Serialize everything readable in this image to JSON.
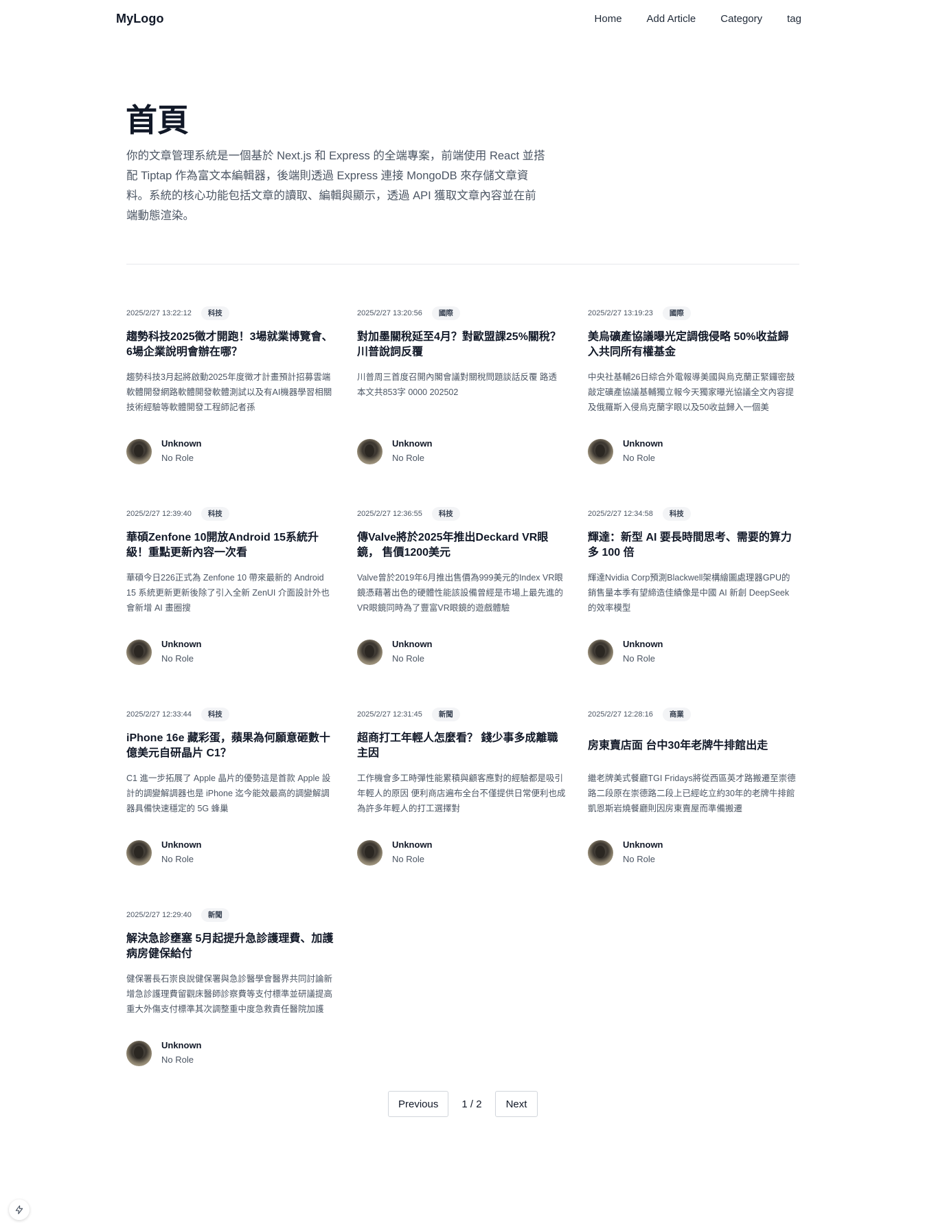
{
  "header": {
    "logo": "MyLogo",
    "nav": [
      "Home",
      "Add Article",
      "Category",
      "tag"
    ]
  },
  "hero": {
    "title": "首頁",
    "description": "你的文章管理系統是一個基於 Next.js 和 Express 的全端專案，前端使用 React 並搭配 Tiptap 作為富文本編輯器，後端則透過 Express 連接 MongoDB 來存儲文章資料。系統的核心功能包括文章的讀取、編輯與顯示，透過 API 獲取文章內容並在前端動態渲染。"
  },
  "articles": [
    {
      "date": "2025/2/27 13:22:12",
      "category": "科技",
      "title": "趨勢科技2025徵才開跑！3場就業博覽會、6場企業說明會辦在哪？",
      "excerpt": "趨勢科技3月起將啟動2025年度徵才計畫預計招募雲端軟體開發網路軟體開發軟體測試以及有AI機器學習相關技術經驗等軟體開發工程師記者孫",
      "author": "Unknown",
      "role": "No Role"
    },
    {
      "date": "2025/2/27 13:20:56",
      "category": "國際",
      "title": "對加墨關稅延至4月？對歐盟課25%關稅？川普說詞反覆",
      "excerpt": "川普周三首度召開內閣會議對關稅問題談話反覆 路透 本文共853字 0000 202502",
      "author": "Unknown",
      "role": "No Role"
    },
    {
      "date": "2025/2/27 13:19:23",
      "category": "國際",
      "title": "美烏礦產協議曝光定調俄侵略 50%收益歸入共同所有權基金",
      "excerpt": "中央社基輔26日綜合外電報導美國與烏克蘭正緊鑼密鼓敲定礦產協議基輔獨立報今天獨家曝光協議全文內容提及俄羅斯入侵烏克蘭字眼以及50收益歸入一個美",
      "author": "Unknown",
      "role": "No Role"
    },
    {
      "date": "2025/2/27 12:39:40",
      "category": "科技",
      "title": "華碩Zenfone 10開放Android 15系統升級！重點更新內容一次看",
      "excerpt": "華碩今日226正式為 Zenfone 10 帶來最新的 Android 15 系統更新更新後除了引入全新 ZenUI 介面設計外也會新增 AI 畫圈搜",
      "author": "Unknown",
      "role": "No Role"
    },
    {
      "date": "2025/2/27 12:36:55",
      "category": "科技",
      "title": "傳Valve將於2025年推出Deckard VR眼鏡， 售價1200美元",
      "excerpt": "Valve曾於2019年6月推出售價為999美元的Index VR眼鏡憑藉著出色的硬體性能該設備曾經是市場上最先進的VR眼鏡同時為了豐富VR眼鏡的遊戲體驗",
      "author": "Unknown",
      "role": "No Role"
    },
    {
      "date": "2025/2/27 12:34:58",
      "category": "科技",
      "title": "輝達：新型 AI 要長時間思考、需要的算力多 100 倍",
      "excerpt": "輝達Nvidia Corp預測Blackwell架構繪圖處理器GPU的銷售量本季有望締造佳績像是中國 AI 新創 DeepSeek 的效率模型",
      "author": "Unknown",
      "role": "No Role"
    },
    {
      "date": "2025/2/27 12:33:44",
      "category": "科技",
      "title": "iPhone 16e 藏彩蛋，蘋果為何願意砸數十億美元自研晶片 C1？",
      "excerpt": "C1 進一步拓展了 Apple 晶片的優勢這是首款 Apple 設計的調變解調器也是 iPhone 迄今能效最高的調變解調器具備快速穩定的 5G 蜂巢",
      "author": "Unknown",
      "role": "No Role"
    },
    {
      "date": "2025/2/27 12:31:45",
      "category": "新聞",
      "title": "超商打工年輕人怎麼看？ 錢少事多成離職主因",
      "excerpt": "工作機會多工時彈性能累積與顧客應對的經驗都是吸引年輕人的原因 便利商店遍布全台不僅提供日常便利也成為許多年輕人的打工選擇對",
      "author": "Unknown",
      "role": "No Role"
    },
    {
      "date": "2025/2/27 12:28:16",
      "category": "商業",
      "title": "房東賣店面 台中30年老牌牛排館出走",
      "excerpt": "繼老牌美式餐廳TGI Fridays將從西區英才路搬遷至崇德路二段原在崇德路二段上已經屹立約30年的老牌牛排館凱恩斯岩燒餐廳則因房東賣屋而準備搬遷",
      "author": "Unknown",
      "role": "No Role"
    },
    {
      "date": "2025/2/27 12:29:40",
      "category": "新聞",
      "title": "解決急診壅塞 5月起提升急診護理費、加護病房健保給付",
      "excerpt": "健保署長石崇良說健保署與急診醫學會醫界共同討論新增急診護理費留觀床醫師診察費等支付標準並研議提高重大外傷支付標準其次調整重中度急救責任醫院加護",
      "author": "Unknown",
      "role": "No Role"
    }
  ],
  "pagination": {
    "previous": "Previous",
    "indicator": "1 / 2",
    "next": "Next"
  },
  "icons": {
    "dev_tools": "lightning-bolt-icon"
  }
}
